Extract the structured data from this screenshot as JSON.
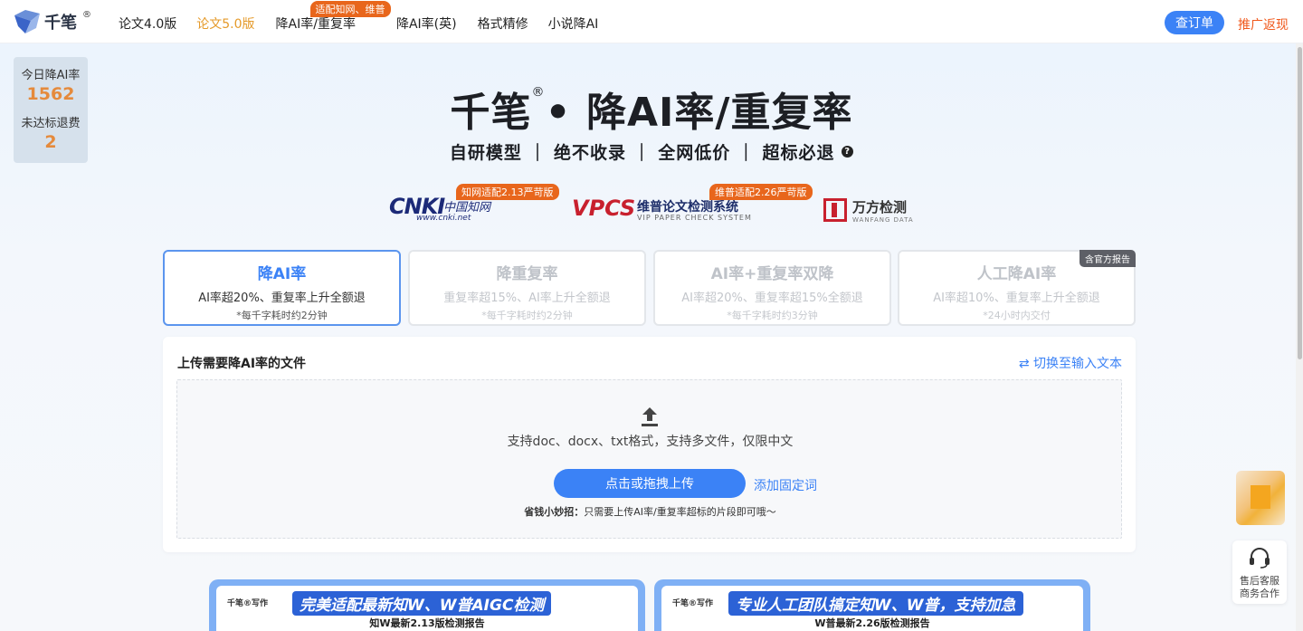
{
  "header": {
    "logo_text": "千笔",
    "logo_reg": "®",
    "nav": [
      {
        "label": "论文4.0版",
        "active": false
      },
      {
        "label": "论文5.0版",
        "active": true
      },
      {
        "label": "降AI率/重复率",
        "active": false,
        "badge": "适配知网、维普"
      },
      {
        "label": "降AI率(英)",
        "active": false
      },
      {
        "label": "格式精修",
        "active": false
      },
      {
        "label": "小说降AI",
        "active": false
      }
    ],
    "orders_button": "查订单",
    "promo_link": "推广返现"
  },
  "stats": {
    "today_label": "今日降AI率",
    "today_value": "1562",
    "refund_label": "未达标退费",
    "refund_value": "2"
  },
  "hero": {
    "title_brand": "千笔",
    "title_reg": "®",
    "title_rest": "• 降AI率/重复率",
    "subtitle": "自研模型 ｜ 绝不收录 ｜ 全网低价 ｜ 超标必退",
    "help_icon": "?"
  },
  "partners": {
    "cnki": {
      "badge": "知网适配2.13严苛版",
      "main": "CNKI",
      "cn": "中国知网",
      "url": "www.cnki.net"
    },
    "vpcs": {
      "badge": "维普适配2.26严苛版",
      "main": "VPCS",
      "cn": "维普论文检测系统",
      "en": "VIP PAPER CHECK SYSTEM"
    },
    "wanfang": {
      "cn": "万方检测",
      "en": "WANFANG DATA"
    }
  },
  "modes": [
    {
      "title": "降AI率",
      "desc": "AI率超20%、重复率上升全额退",
      "note": "*每千字耗时约2分钟",
      "active": true
    },
    {
      "title": "降重复率",
      "desc": "重复率超15%、AI率上升全额退",
      "note": "*每千字耗时约2分钟",
      "active": false
    },
    {
      "title": "AI率+重复率双降",
      "desc": "AI率超20%、重复率超15%全额退",
      "note": "*每千字耗时约3分钟",
      "active": false
    },
    {
      "title": "人工降AI率",
      "desc": "AI率超10%、重复率上升全额退",
      "note": "*24小时内交付",
      "active": false,
      "tag": "含官方报告"
    }
  ],
  "upload": {
    "title": "上传需要降AI率的文件",
    "switch_link": "⇄ 切换至输入文本",
    "hint": "支持doc、docx、txt格式，支持多文件，仅限中文",
    "button": "点击或拖拽上传",
    "fixed_words": "添加固定词",
    "tip_bold": "省钱小妙招：",
    "tip_text": "只需要上传AI率/重复率超标的片段即可哦～"
  },
  "banners": [
    {
      "logo": "千笔®写作",
      "head": "完美适配最新知W、W普AIGC检测",
      "sub": "知W最新2.13版检测报告"
    },
    {
      "logo": "千笔®写作",
      "head": "专业人工团队搞定知W、W普，支持加急",
      "sub": "W普最新2.26版检测报告"
    }
  ],
  "service": {
    "line1": "售后客服",
    "line2": "商务合作"
  },
  "colors": {
    "primary": "#3b82f6",
    "accent_orange": "#e8661c",
    "active_nav": "#e59a2a",
    "promo": "#f0591d"
  }
}
